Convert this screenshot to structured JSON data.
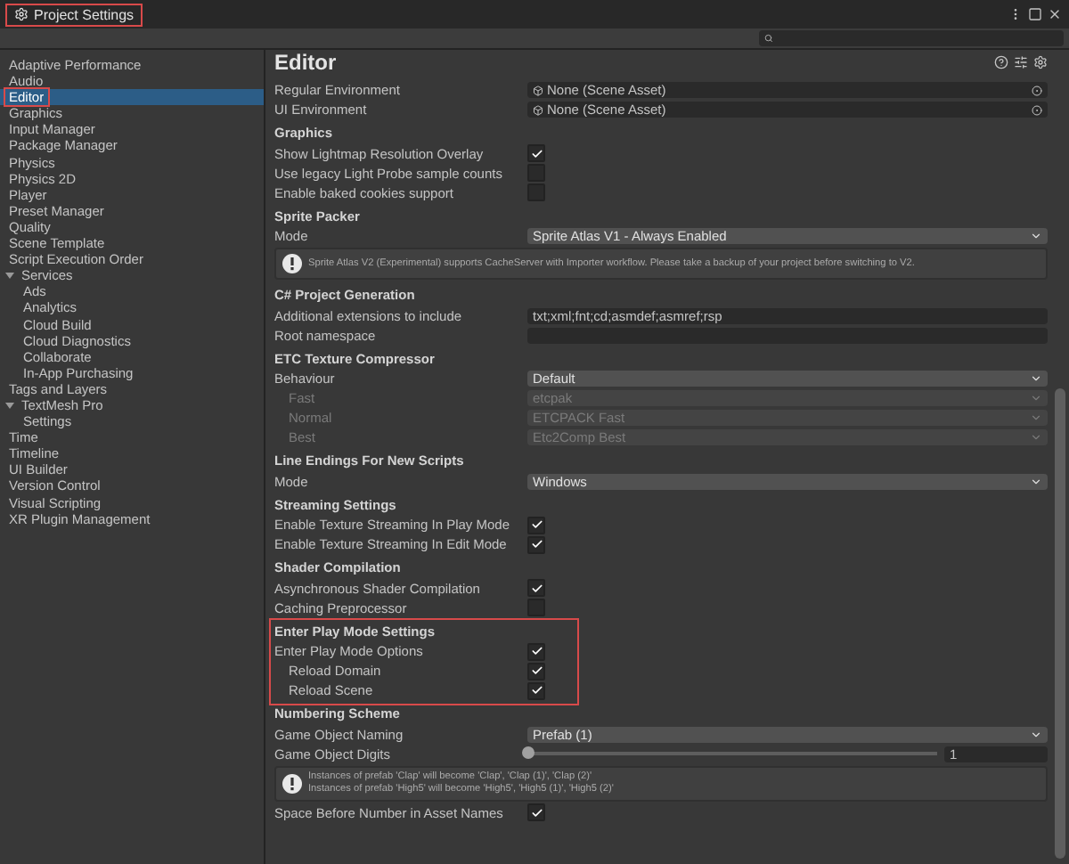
{
  "window": {
    "title": "Project Settings",
    "highlighted": true
  },
  "sidebar": {
    "items": [
      {
        "label": "Adaptive Performance",
        "selected": false,
        "highlighted": false
      },
      {
        "label": "Audio",
        "selected": false,
        "highlighted": false
      },
      {
        "label": "Editor",
        "selected": true,
        "highlighted": true
      },
      {
        "label": "Graphics",
        "selected": false,
        "highlighted": false
      },
      {
        "label": "Input Manager",
        "selected": false,
        "highlighted": false
      },
      {
        "label": "Package Manager",
        "selected": false,
        "highlighted": false
      },
      {
        "label": "Physics",
        "selected": false,
        "highlighted": false
      },
      {
        "label": "Physics 2D",
        "selected": false,
        "highlighted": false
      },
      {
        "label": "Player",
        "selected": false,
        "highlighted": false
      },
      {
        "label": "Preset Manager",
        "selected": false,
        "highlighted": false
      },
      {
        "label": "Quality",
        "selected": false,
        "highlighted": false
      },
      {
        "label": "Scene Template",
        "selected": false,
        "highlighted": false
      },
      {
        "label": "Script Execution Order",
        "selected": false,
        "highlighted": false
      },
      {
        "label": "Services",
        "selected": false,
        "highlighted": false,
        "expanded": true,
        "children": [
          {
            "label": "Ads",
            "selected": false,
            "highlighted": false
          },
          {
            "label": "Analytics",
            "selected": false,
            "highlighted": false
          },
          {
            "label": "Cloud Build",
            "selected": false,
            "highlighted": false
          },
          {
            "label": "Cloud Diagnostics",
            "selected": false,
            "highlighted": false
          },
          {
            "label": "Collaborate",
            "selected": false,
            "highlighted": false
          },
          {
            "label": "In-App Purchasing",
            "selected": false,
            "highlighted": false
          }
        ]
      },
      {
        "label": "Tags and Layers",
        "selected": false,
        "highlighted": false
      },
      {
        "label": "TextMesh Pro",
        "selected": false,
        "highlighted": false,
        "expanded": true,
        "children": [
          {
            "label": "Settings",
            "selected": false,
            "highlighted": false
          }
        ]
      },
      {
        "label": "Time",
        "selected": false,
        "highlighted": false
      },
      {
        "label": "Timeline",
        "selected": false,
        "highlighted": false
      },
      {
        "label": "UI Builder",
        "selected": false,
        "highlighted": false
      },
      {
        "label": "Version Control",
        "selected": false,
        "highlighted": false
      },
      {
        "label": "Visual Scripting",
        "selected": false,
        "highlighted": false
      },
      {
        "label": "XR Plugin Management",
        "selected": false,
        "highlighted": false
      }
    ]
  },
  "panel": {
    "title": "Editor",
    "sections": [
      {
        "highlighted": false,
        "rows": [
          {
            "kind": "object",
            "label": "Regular Environment",
            "value": "None (Scene Asset)"
          },
          {
            "kind": "object",
            "label": "UI Environment",
            "value": "None (Scene Asset)"
          }
        ]
      },
      {
        "title": "Graphics",
        "highlighted": false,
        "rows": [
          {
            "kind": "checkbox",
            "label": "Show Lightmap Resolution Overlay",
            "checked": true
          },
          {
            "kind": "checkbox",
            "label": "Use legacy Light Probe sample counts",
            "checked": false
          },
          {
            "kind": "checkbox",
            "label": "Enable baked cookies support",
            "checked": false
          }
        ]
      },
      {
        "title": "Sprite Packer",
        "highlighted": false,
        "rows": [
          {
            "kind": "dropdown",
            "label": "Mode",
            "value": "Sprite Atlas V1 - Always Enabled",
            "disabled": false
          },
          {
            "kind": "help",
            "lines": [
              "Sprite Atlas V2 (Experimental) supports CacheServer with Importer workflow. Please take a backup of your project before switching to V2."
            ]
          }
        ]
      },
      {
        "title": "C# Project Generation",
        "highlighted": false,
        "rows": [
          {
            "kind": "text",
            "label": "Additional extensions to include",
            "value": "txt;xml;fnt;cd;asmdef;asmref;rsp"
          },
          {
            "kind": "text",
            "label": "Root namespace",
            "value": ""
          }
        ]
      },
      {
        "title": "ETC Texture Compressor",
        "highlighted": false,
        "rows": [
          {
            "kind": "dropdown",
            "label": "Behaviour",
            "value": "Default",
            "disabled": false,
            "children": [
              {
                "kind": "dropdown",
                "label": "Fast",
                "value": "etcpak",
                "disabled": true
              },
              {
                "kind": "dropdown",
                "label": "Normal",
                "value": "ETCPACK Fast",
                "disabled": true
              },
              {
                "kind": "dropdown",
                "label": "Best",
                "value": "Etc2Comp Best",
                "disabled": true
              }
            ]
          }
        ]
      },
      {
        "title": "Line Endings For New Scripts",
        "highlighted": false,
        "rows": [
          {
            "kind": "dropdown",
            "label": "Mode",
            "value": "Windows",
            "disabled": false
          }
        ]
      },
      {
        "title": "Streaming Settings",
        "highlighted": false,
        "rows": [
          {
            "kind": "checkbox",
            "label": "Enable Texture Streaming In Play Mode",
            "checked": true
          },
          {
            "kind": "checkbox",
            "label": "Enable Texture Streaming In Edit Mode",
            "checked": true
          }
        ]
      },
      {
        "title": "Shader Compilation",
        "highlighted": false,
        "rows": [
          {
            "kind": "checkbox",
            "label": "Asynchronous Shader Compilation",
            "checked": true
          },
          {
            "kind": "checkbox",
            "label": "Caching Preprocessor",
            "checked": false
          }
        ]
      },
      {
        "title": "Enter Play Mode Settings",
        "highlighted": true,
        "rows": [
          {
            "kind": "checkbox",
            "label": "Enter Play Mode Options",
            "checked": true,
            "children": [
              {
                "kind": "checkbox",
                "label": "Reload Domain",
                "checked": true
              },
              {
                "kind": "checkbox",
                "label": "Reload Scene",
                "checked": true
              }
            ]
          }
        ]
      },
      {
        "title": "Numbering Scheme",
        "highlighted": false,
        "rows": [
          {
            "kind": "dropdown",
            "label": "Game Object Naming",
            "value": "Prefab (1)",
            "disabled": false
          },
          {
            "kind": "slider",
            "label": "Game Object Digits",
            "level": 0,
            "value": "1"
          },
          {
            "kind": "help",
            "lines": [
              "Instances of prefab 'Clap' will become 'Clap', 'Clap (1)', 'Clap (2)'",
              "Instances of prefab 'High5' will become 'High5', 'High5 (1)', 'High5 (2)'"
            ]
          },
          {
            "kind": "checkbox",
            "label": "Space Before Number in Asset Names",
            "checked": true
          }
        ]
      }
    ]
  }
}
